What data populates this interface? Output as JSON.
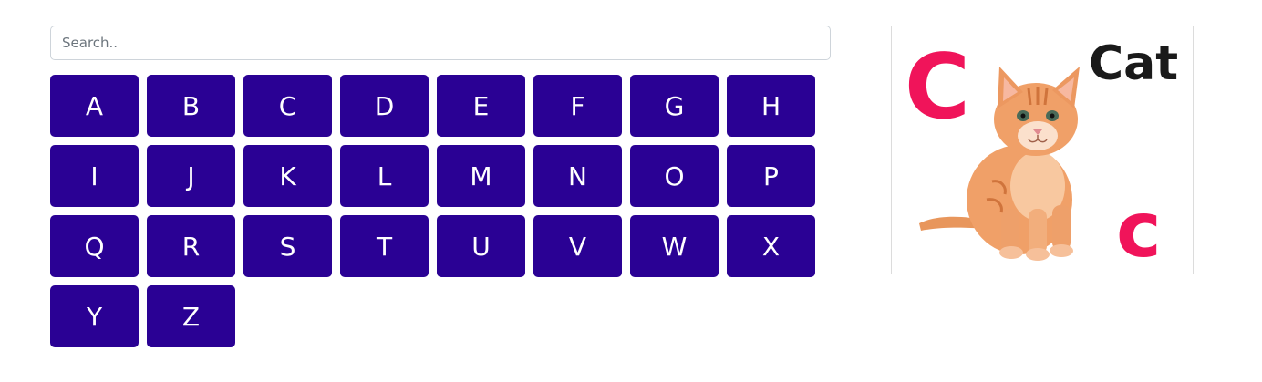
{
  "search": {
    "placeholder": "Search..",
    "value": ""
  },
  "letters": [
    "A",
    "B",
    "C",
    "D",
    "E",
    "F",
    "G",
    "H",
    "I",
    "J",
    "K",
    "L",
    "M",
    "N",
    "O",
    "P",
    "Q",
    "R",
    "S",
    "T",
    "U",
    "V",
    "W",
    "X",
    "Y",
    "Z"
  ],
  "card": {
    "upper_letter": "C",
    "word": "Cat",
    "lower_letter": "c",
    "animal": "cat-kitten-image"
  },
  "colors": {
    "button_bg": "#2a0194",
    "button_text": "#ffffff",
    "letter_accent": "#f0145a",
    "word_color": "#1a1a1a",
    "kitten": "#f0a068"
  }
}
